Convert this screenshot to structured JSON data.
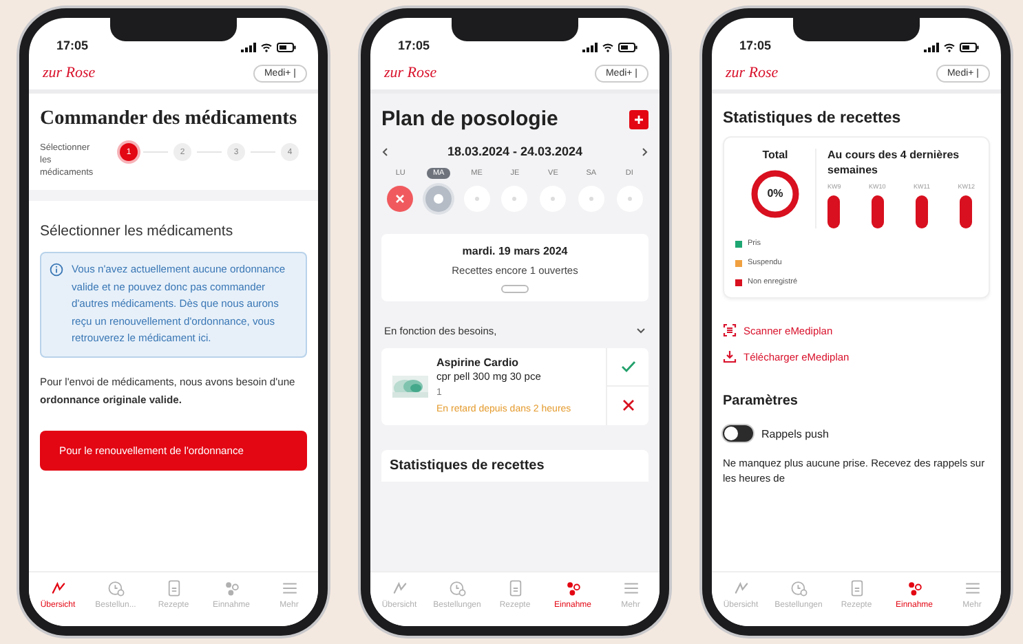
{
  "phones": [
    {
      "kind": "order",
      "time": "17:05",
      "logo": "zur Rose",
      "chip": "Medi+ |",
      "title": "Commander des médicaments",
      "stepper": {
        "label": "Sélectionner les médicaments",
        "steps": [
          {
            "label": "1",
            "selected": true
          },
          {
            "label": "2",
            "selected": false
          },
          {
            "label": "3",
            "selected": false
          },
          {
            "label": "4",
            "selected": false
          }
        ]
      },
      "section_title": "Sélectionner les médicaments",
      "info": "Vous n'avez actuellement aucune ordonnance valide et ne pouvez donc pas commander d'autres médicaments. Dès que nous aurons reçu un renouvellement d'ordonnance, vous retrouverez le médicament ici.",
      "note": "Pour l'envoi de médicaments, nous avons besoin d'une **ordonnance originale valide.**",
      "button": "Pour le renouvellement de l'ordonnance",
      "tabs": [
        {
          "label": "Übersicht",
          "selected": true
        },
        {
          "label": "Bestellun...",
          "selected": false
        },
        {
          "label": "Rezepte",
          "selected": false
        },
        {
          "label": "Einnahme",
          "selected": false
        },
        {
          "label": "Mehr",
          "selected": false
        }
      ]
    },
    {
      "kind": "plan",
      "time": "17:05",
      "logo": "zur Rose",
      "chip": "Medi+ |",
      "title": "Plan de posologie",
      "date_range": "18.03.2024 - 24.03.2024",
      "days": [
        {
          "label": "LU",
          "selected": false,
          "kind": "missed"
        },
        {
          "label": "MA",
          "selected": true,
          "kind": "current"
        },
        {
          "label": "ME",
          "selected": false,
          "kind": "empty"
        },
        {
          "label": "JE",
          "selected": false,
          "kind": "empty"
        },
        {
          "label": "VE",
          "selected": false,
          "kind": "empty"
        },
        {
          "label": "SA",
          "selected": false,
          "kind": "empty"
        },
        {
          "label": "DI",
          "selected": false,
          "kind": "empty"
        }
      ],
      "day_card": {
        "date": "mardi. 19 mars 2024",
        "summary": "Recettes encore 1 ouvertes"
      },
      "group": {
        "label": "En fonction des besoins,",
        "expanded": true
      },
      "medication": {
        "name": "Aspirine Cardio",
        "dose": "cpr pell 300 mg 30 pce",
        "quantity": "1",
        "status": "En retard depuis dans 2 heures"
      },
      "next_section": "Statistiques de recettes",
      "tabs": [
        {
          "label": "Übersicht",
          "selected": false
        },
        {
          "label": "Bestellungen",
          "selected": false
        },
        {
          "label": "Rezepte",
          "selected": false
        },
        {
          "label": "Einnahme",
          "selected": true
        },
        {
          "label": "Mehr",
          "selected": false
        }
      ]
    },
    {
      "kind": "stats",
      "time": "17:05",
      "logo": "zur Rose",
      "chip": "Medi+ |",
      "title": "Statistiques de recettes",
      "total": {
        "label": "Total",
        "value": "0%"
      },
      "weeks": {
        "title": "Au cours des 4 dernières semaines",
        "labels": [
          "KW9",
          "KW10",
          "KW11",
          "KW12"
        ]
      },
      "legend": [
        {
          "label": "Pris",
          "color": "#1ea672"
        },
        {
          "label": "Suspendu",
          "color": "#f0a040"
        },
        {
          "label": "Non enregistré",
          "color": "#d8101f"
        }
      ],
      "links": [
        "Scanner eMediplan",
        "Télécharger eMediplan"
      ],
      "settings_title": "Paramètres",
      "toggle": {
        "label": "Rappels push",
        "on": false
      },
      "description": "Ne manquez plus aucune prise. Recevez des rappels sur les heures de",
      "tabs": [
        {
          "label": "Übersicht",
          "selected": false
        },
        {
          "label": "Bestellungen",
          "selected": false
        },
        {
          "label": "Rezepte",
          "selected": false
        },
        {
          "label": "Einnahme",
          "selected": true
        },
        {
          "label": "Mehr",
          "selected": false
        }
      ]
    }
  ]
}
